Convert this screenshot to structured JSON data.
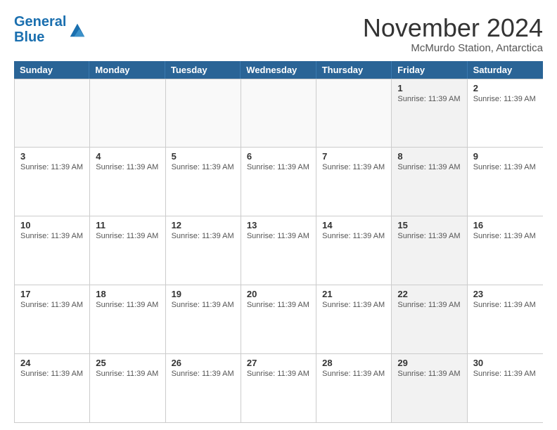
{
  "logo": {
    "line1": "General",
    "line2": "Blue"
  },
  "title": "November 2024",
  "location": "McMurdo Station, Antarctica",
  "days_header": [
    "Sunday",
    "Monday",
    "Tuesday",
    "Wednesday",
    "Thursday",
    "Friday",
    "Saturday"
  ],
  "sunrise": "Sunrise: 11:39 AM",
  "weeks": [
    [
      {
        "num": "",
        "info": "",
        "empty": true
      },
      {
        "num": "",
        "info": "",
        "empty": true
      },
      {
        "num": "",
        "info": "",
        "empty": true
      },
      {
        "num": "",
        "info": "",
        "empty": true
      },
      {
        "num": "",
        "info": "",
        "empty": true
      },
      {
        "num": "1",
        "info": "Sunrise: 11:39 AM",
        "shaded": true
      },
      {
        "num": "2",
        "info": "Sunrise: 11:39 AM",
        "shaded": false
      }
    ],
    [
      {
        "num": "3",
        "info": "Sunrise: 11:39 AM",
        "shaded": false
      },
      {
        "num": "4",
        "info": "Sunrise: 11:39 AM",
        "shaded": false
      },
      {
        "num": "5",
        "info": "Sunrise: 11:39 AM",
        "shaded": false
      },
      {
        "num": "6",
        "info": "Sunrise: 11:39 AM",
        "shaded": false
      },
      {
        "num": "7",
        "info": "Sunrise: 11:39 AM",
        "shaded": false
      },
      {
        "num": "8",
        "info": "Sunrise: 11:39 AM",
        "shaded": true
      },
      {
        "num": "9",
        "info": "Sunrise: 11:39 AM",
        "shaded": false
      }
    ],
    [
      {
        "num": "10",
        "info": "Sunrise: 11:39 AM",
        "shaded": false
      },
      {
        "num": "11",
        "info": "Sunrise: 11:39 AM",
        "shaded": false
      },
      {
        "num": "12",
        "info": "Sunrise: 11:39 AM",
        "shaded": false
      },
      {
        "num": "13",
        "info": "Sunrise: 11:39 AM",
        "shaded": false
      },
      {
        "num": "14",
        "info": "Sunrise: 11:39 AM",
        "shaded": false
      },
      {
        "num": "15",
        "info": "Sunrise: 11:39 AM",
        "shaded": true
      },
      {
        "num": "16",
        "info": "Sunrise: 11:39 AM",
        "shaded": false
      }
    ],
    [
      {
        "num": "17",
        "info": "Sunrise: 11:39 AM",
        "shaded": false
      },
      {
        "num": "18",
        "info": "Sunrise: 11:39 AM",
        "shaded": false
      },
      {
        "num": "19",
        "info": "Sunrise: 11:39 AM",
        "shaded": false
      },
      {
        "num": "20",
        "info": "Sunrise: 11:39 AM",
        "shaded": false
      },
      {
        "num": "21",
        "info": "Sunrise: 11:39 AM",
        "shaded": false
      },
      {
        "num": "22",
        "info": "Sunrise: 11:39 AM",
        "shaded": true
      },
      {
        "num": "23",
        "info": "Sunrise: 11:39 AM",
        "shaded": false
      }
    ],
    [
      {
        "num": "24",
        "info": "Sunrise: 11:39 AM",
        "shaded": false
      },
      {
        "num": "25",
        "info": "Sunrise: 11:39 AM",
        "shaded": false
      },
      {
        "num": "26",
        "info": "Sunrise: 11:39 AM",
        "shaded": false
      },
      {
        "num": "27",
        "info": "Sunrise: 11:39 AM",
        "shaded": false
      },
      {
        "num": "28",
        "info": "Sunrise: 11:39 AM",
        "shaded": false
      },
      {
        "num": "29",
        "info": "Sunrise: 11:39 AM",
        "shaded": true
      },
      {
        "num": "30",
        "info": "Sunrise: 11:39 AM",
        "shaded": false
      }
    ]
  ]
}
